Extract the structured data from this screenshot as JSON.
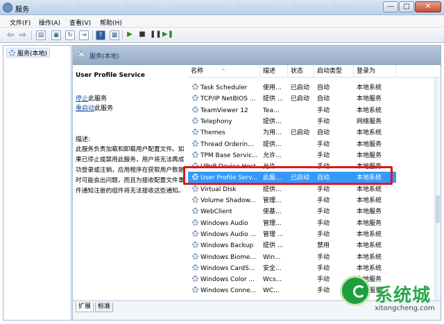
{
  "window": {
    "title": "服务",
    "controls": [
      "—",
      "□",
      "✕"
    ]
  },
  "menu": {
    "items": [
      {
        "label": "文件(F)"
      },
      {
        "label": "操作(A)"
      },
      {
        "label": "查看(V)"
      },
      {
        "label": "帮助(H)"
      }
    ]
  },
  "toolbar": {
    "icons": [
      "back-icon",
      "forward-icon",
      "show-tree-icon",
      "properties-icon",
      "refresh-icon",
      "export-icon",
      "help-icon",
      "console-icon",
      "play-icon",
      "stop-icon",
      "pause-icon",
      "restart-icon"
    ]
  },
  "tree": {
    "root_label": "服务(本地)"
  },
  "pane": {
    "header_title": "服务(本地)",
    "selected_service_name": "User Profile Service",
    "stop_link": "停止",
    "stop_suffix": "此服务",
    "restart_link": "重启动",
    "restart_suffix": "此服务",
    "description_label": "描述:",
    "description_text": "此服务负责加载和卸载用户配置文件。如果已停止或禁用此服务，用户将无法再成功登录或注销，应用程序在获取用户数据时可能会出问题，而且为接收配置文件事件通知注册的组件将无法接收这些通知。"
  },
  "table": {
    "columns": [
      "名称",
      "描述",
      "状态",
      "启动类型",
      "登录为"
    ],
    "rows": [
      {
        "name": "Task Scheduler",
        "desc": "使用...",
        "status": "已启动",
        "startup": "自动",
        "logon": "本地系统"
      },
      {
        "name": "TCP/IP NetBIOS ...",
        "desc": "提供 ...",
        "status": "已启动",
        "startup": "自动",
        "logon": "本地服务"
      },
      {
        "name": "TeamViewer 12",
        "desc": "Tea...",
        "status": "",
        "startup": "手动",
        "logon": "本地系统"
      },
      {
        "name": "Telephony",
        "desc": "提供...",
        "status": "",
        "startup": "手动",
        "logon": "网络服务"
      },
      {
        "name": "Themes",
        "desc": "为用...",
        "status": "已启动",
        "startup": "自动",
        "logon": "本地系统"
      },
      {
        "name": "Thread Orderin...",
        "desc": "提供...",
        "status": "",
        "startup": "手动",
        "logon": "本地服务"
      },
      {
        "name": "TPM Base Servic...",
        "desc": "允许...",
        "status": "",
        "startup": "手动",
        "logon": "本地服务"
      },
      {
        "name": "UPnP Device Host",
        "desc": "允许...",
        "status": "",
        "startup": "手动",
        "logon": "本地服务"
      },
      {
        "name": "User Profile Serv...",
        "desc": "此服...",
        "status": "已启动",
        "startup": "自动",
        "logon": "本地系统",
        "selected": true
      },
      {
        "name": "Virtual Disk",
        "desc": "提供...",
        "status": "",
        "startup": "手动",
        "logon": "本地系统"
      },
      {
        "name": "Volume Shadow...",
        "desc": "管理...",
        "status": "",
        "startup": "手动",
        "logon": "本地系统"
      },
      {
        "name": "WebClient",
        "desc": "使基...",
        "status": "",
        "startup": "手动",
        "logon": "本地服务"
      },
      {
        "name": "Windows Audio",
        "desc": "管理...",
        "status": "",
        "startup": "手动",
        "logon": "本地服务"
      },
      {
        "name": "Windows Audio ...",
        "desc": "管理 ...",
        "status": "",
        "startup": "手动",
        "logon": "本地系统"
      },
      {
        "name": "Windows Backup",
        "desc": "提供 ...",
        "status": "",
        "startup": "禁用",
        "logon": "本地系统"
      },
      {
        "name": "Windows Biome...",
        "desc": "Win...",
        "status": "",
        "startup": "手动",
        "logon": "本地系统"
      },
      {
        "name": "Windows CardS...",
        "desc": "安全...",
        "status": "",
        "startup": "手动",
        "logon": "本地系统"
      },
      {
        "name": "Windows Color ...",
        "desc": "Wcs...",
        "status": "",
        "startup": "手动",
        "logon": "本地服务"
      },
      {
        "name": "Windows Conne...",
        "desc": "WC...",
        "status": "",
        "startup": "手动",
        "logon": "本地服务"
      }
    ]
  },
  "tabs": [
    "扩展",
    "标准"
  ],
  "watermark": {
    "brand": "系统城",
    "url": "xitongcheng.com"
  },
  "colors": {
    "selection": "#3399ff",
    "highlight_box": "#e31515",
    "link": "#1a53a8"
  }
}
